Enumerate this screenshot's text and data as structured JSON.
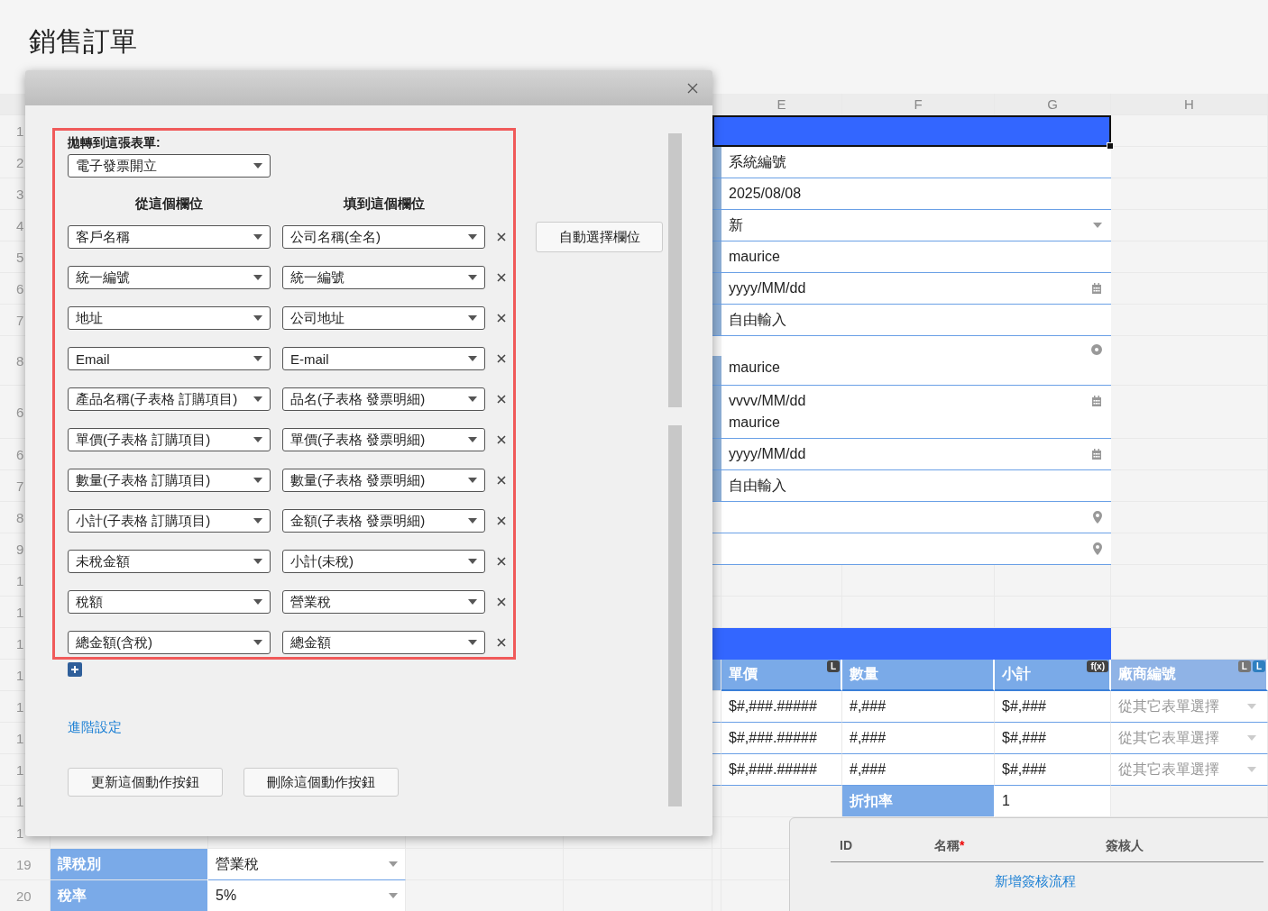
{
  "page_title": "銷售訂單",
  "sheet": {
    "columns": [
      "E",
      "F",
      "G",
      "H"
    ],
    "rows": [
      {
        "number": "1",
        "kind": "band",
        "selected": true
      },
      {
        "number": "2",
        "kind": "text",
        "value": "系統編號"
      },
      {
        "number": "3",
        "kind": "text",
        "value": "2025/08/08"
      },
      {
        "number": "4",
        "kind": "select",
        "value": "新"
      },
      {
        "number": "5",
        "kind": "text",
        "value": "maurice"
      },
      {
        "number": "6",
        "kind": "date",
        "value": "yyyy/MM/dd"
      },
      {
        "number": "7",
        "kind": "text",
        "value": "自由輸入"
      },
      {
        "number": "8",
        "kind": "person",
        "value": "maurice"
      },
      {
        "number": "6",
        "kind": "date_person",
        "value": "vvvv/MM/dd",
        "second": "maurice"
      },
      {
        "number": "6",
        "kind": "date",
        "value": "yyyy/MM/dd"
      },
      {
        "number": "7",
        "kind": "text",
        "value": "自由輸入"
      },
      {
        "number": "8",
        "kind": "location"
      },
      {
        "number": "9",
        "kind": "location"
      },
      {
        "number": "1",
        "kind": "empty"
      },
      {
        "number": "1",
        "kind": "empty"
      },
      {
        "number": "1",
        "kind": "band",
        "selected": false
      },
      {
        "number": "1",
        "kind": "table_header",
        "cells": [
          {
            "label": "單價",
            "badges": [
              "L"
            ],
            "disabled": false
          },
          {
            "label": "數量",
            "disabled": false
          },
          {
            "label": "小計",
            "badges": [
              "f(x)"
            ],
            "disabled": false
          },
          {
            "label": "廠商編號",
            "badges": [
              "L",
              "L"
            ],
            "disabled": true
          }
        ]
      },
      {
        "number": "1",
        "kind": "table_row",
        "cells": [
          "$#,###.#####",
          "#,###",
          "$#,###"
        ],
        "placeholder": "從其它表單選擇"
      },
      {
        "number": "1",
        "kind": "table_row",
        "cells": [
          "$#,###.#####",
          "#,###",
          "$#,###"
        ],
        "placeholder": "從其它表單選擇"
      },
      {
        "number": "1",
        "kind": "table_row",
        "cells": [
          "$#,###.#####",
          "#,###",
          "$#,###"
        ],
        "placeholder": "從其它表單選擇"
      },
      {
        "number": "1",
        "kind": "discount",
        "heading": "折扣率",
        "amount": "1"
      },
      {
        "number": "1",
        "kind": "empty"
      },
      {
        "number": "19",
        "kind": "tax",
        "label": "課稅別",
        "value": "營業稅"
      },
      {
        "number": "20",
        "kind": "tax",
        "label": "稅率",
        "value": "5%"
      }
    ]
  },
  "dialog": {
    "target_label": "拋轉到這張表單:",
    "target_value": "電子發票開立",
    "from_heading": "從這個欄位",
    "to_heading": "填到這個欄位",
    "mappings": [
      {
        "from": "客戶名稱",
        "to": "公司名稱(全名)"
      },
      {
        "from": "統一編號",
        "to": "統一編號"
      },
      {
        "from": "地址",
        "to": "公司地址"
      },
      {
        "from": "Email",
        "to": "E-mail"
      },
      {
        "from": "產品名稱(子表格 訂購項目)",
        "to": "品名(子表格 發票明細)"
      },
      {
        "from": "單價(子表格 訂購項目)",
        "to": "單價(子表格 發票明細)"
      },
      {
        "from": "數量(子表格 訂購項目)",
        "to": "數量(子表格 發票明細)"
      },
      {
        "from": "小計(子表格 訂購項目)",
        "to": "金額(子表格 發票明細)"
      },
      {
        "from": "未稅金額",
        "to": "小計(未稅)"
      },
      {
        "from": "稅額",
        "to": "營業稅"
      },
      {
        "from": "總金額(含稅)",
        "to": "總金額"
      }
    ],
    "auto_button": "自動選擇欄位",
    "advanced_link": "進階設定",
    "buttons": [
      "更新這個動作按鈕",
      "刪除這個動作按鈕"
    ]
  },
  "approval": {
    "columns": [
      {
        "label": "ID"
      },
      {
        "label": "名稱",
        "required_mark": "*"
      },
      {
        "label": "簽核人"
      }
    ],
    "add_link": "新增簽核流程"
  }
}
